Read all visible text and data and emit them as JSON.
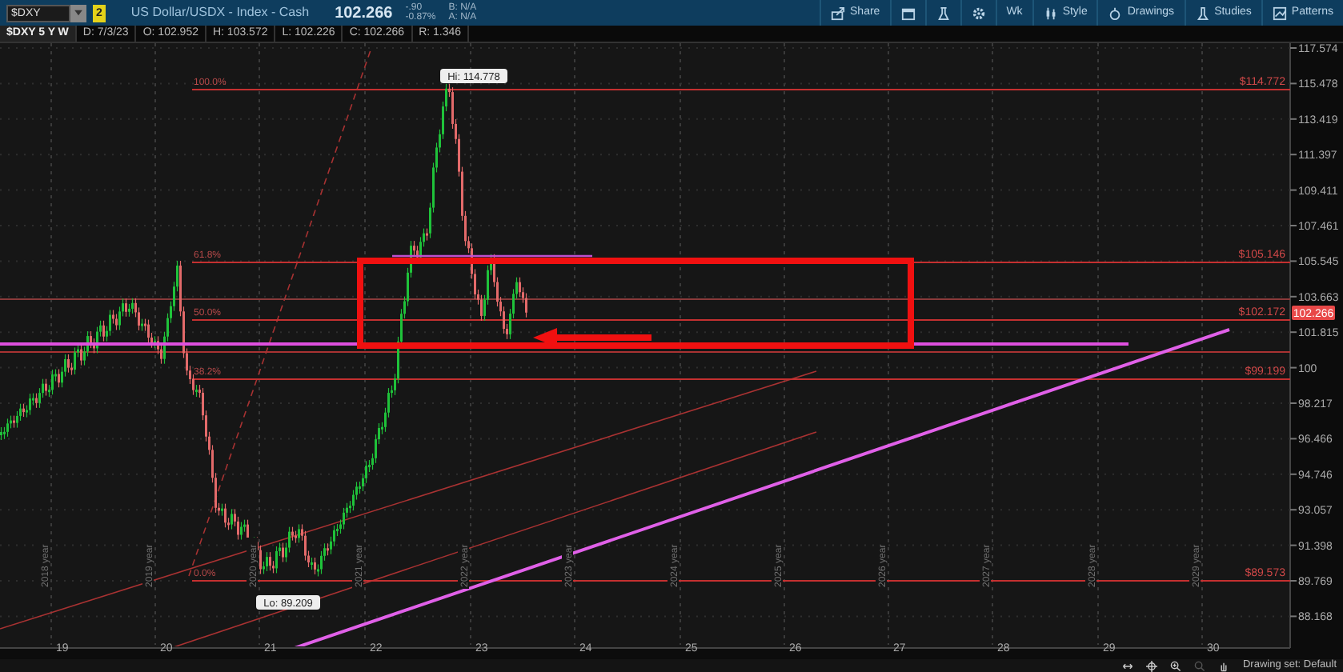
{
  "toolbar": {
    "symbol_value": "$DXY",
    "alert_badge": "2",
    "instrument": "US Dollar/USDX - Index - Cash",
    "last_price": "102.266",
    "change": "-.90",
    "change_percent": "-0.87%",
    "bid": "B: N/A",
    "ask": "A: N/A",
    "buttons": [
      {
        "kind": "share",
        "label": "Share"
      },
      {
        "kind": "window"
      },
      {
        "kind": "flask"
      },
      {
        "kind": "gear"
      },
      {
        "kind": "text",
        "label": "Wk"
      },
      {
        "kind": "style",
        "label": "Style"
      },
      {
        "kind": "drawings",
        "label": "Drawings"
      },
      {
        "kind": "studies",
        "label": "Studies"
      },
      {
        "kind": "patterns",
        "label": "Patterns"
      }
    ]
  },
  "info_bar": [
    "$DXY 5 Y W",
    "D: 7/3/23",
    "O: 102.952",
    "H: 103.572",
    "L: 102.226",
    "C: 102.266",
    "R: 1.346"
  ],
  "chart": {
    "y_axis_labels": [
      "117.574",
      "115.478",
      "113.419",
      "111.397",
      "109.411",
      "107.461",
      "105.545",
      "103.663",
      "101.815",
      "100",
      "98.217",
      "96.466",
      "94.746",
      "93.057",
      "91.398",
      "89.769",
      "88.168"
    ],
    "x_axis_labels": [
      "19",
      "20",
      "21",
      "22",
      "23",
      "24",
      "25",
      "26",
      "27",
      "28",
      "29",
      "30"
    ],
    "year_labels": [
      "2018 year",
      "2019 year",
      "2020 year",
      "2021 year",
      "2022 year",
      "2023 year",
      "2024 year",
      "2025 year",
      "2026 year",
      "2027 year",
      "2028 year",
      "2029 year"
    ],
    "fib_levels": [
      {
        "percent": "100.0%",
        "price": "$114.772"
      },
      {
        "percent": "61.8%",
        "price": "$105.146"
      },
      {
        "percent": "50.0%",
        "price": "$102.172"
      },
      {
        "percent": "38.2%",
        "price": "$99.199"
      },
      {
        "percent": "0.0%",
        "price": "$89.573"
      }
    ],
    "high_label": "Hi: 114.778",
    "low_label": "Lo: 89.209",
    "current_price": "102.266"
  },
  "status_bar": {
    "drawing_set": "Drawing set: Default"
  }
}
